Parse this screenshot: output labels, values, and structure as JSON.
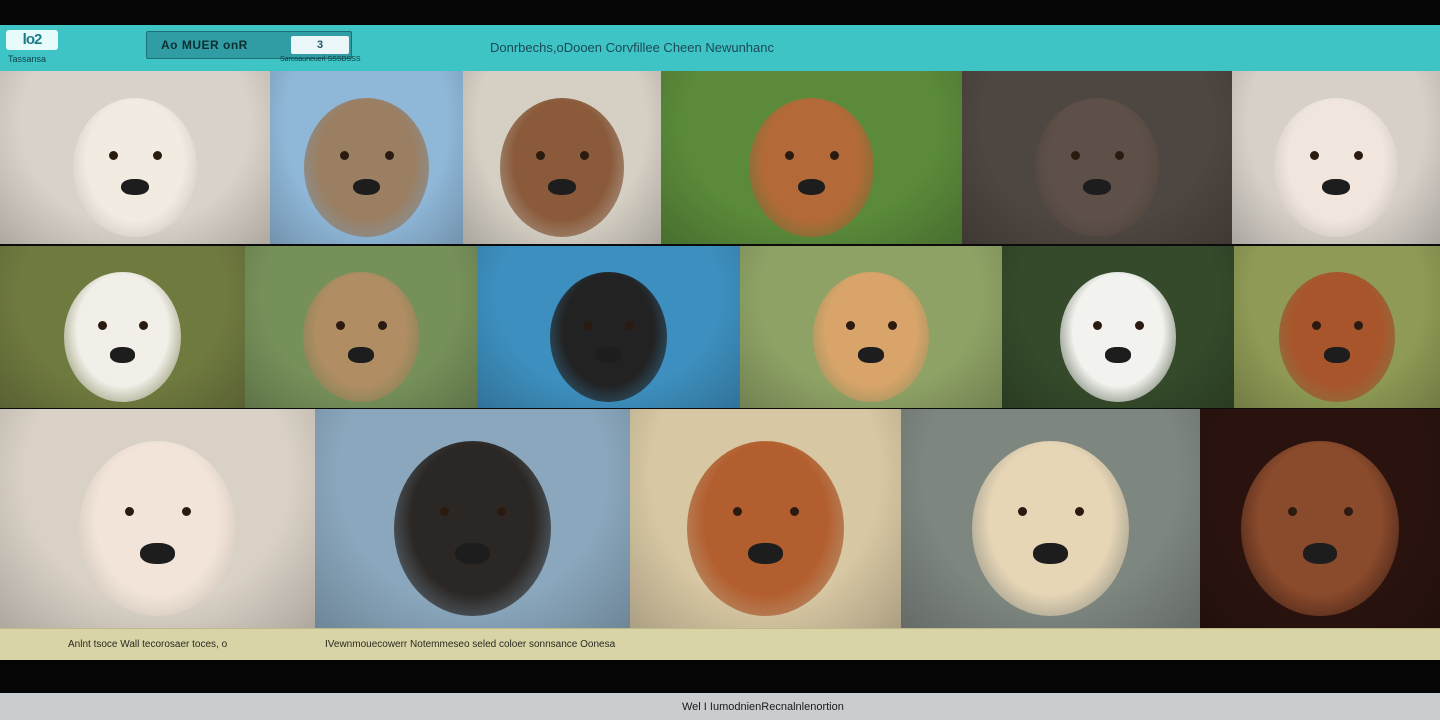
{
  "header": {
    "logo": "lo2",
    "logo_sub": "Tassansa",
    "brand_label": "Ao MUER onR",
    "brand_badge": "3",
    "brand_sub": "Sarcoauneuerl SSSDSSS",
    "title": "Donrbechs,oDooen Corvfillee Cheen Newunhanc"
  },
  "tiles": [
    {
      "label": "Dog photo 1",
      "bg": "#d9d2c8",
      "fur": "#f1ebe2"
    },
    {
      "label": "Dog photo 2",
      "bg": "#8fb7d8",
      "fur": "#9a7f63"
    },
    {
      "label": "Dog photo 3",
      "bg": "#d5cfc4",
      "fur": "#8a5a3a"
    },
    {
      "label": "Dog photo 4",
      "bg": "#5a8a3a",
      "fur": "#b36a38"
    },
    {
      "label": "Dog photo 5",
      "bg": "#4e4640",
      "fur": "#5e5048"
    },
    {
      "label": "Dog photo 6",
      "bg": "#d6d0c8",
      "fur": "#f0e6de"
    },
    {
      "label": "Dog photo 7",
      "bg": "#6f7a3f",
      "fur": "#f2efe8"
    },
    {
      "label": "Dog photo 8",
      "bg": "#76905a",
      "fur": "#b08d63"
    },
    {
      "label": "Dog photo 9",
      "bg": "#3d8fbf",
      "fur": "#222222"
    },
    {
      "label": "Dog photo 10",
      "bg": "#8ea265",
      "fur": "#d9a46a"
    },
    {
      "label": "Dog photo 11",
      "bg": "#344a2a",
      "fur": "#f2f2ef"
    },
    {
      "label": "Dog photo 12",
      "bg": "#8e9a55",
      "fur": "#a8552c"
    },
    {
      "label": "Dog photo 13",
      "bg": "#d9d1c6",
      "fur": "#f2e4d8"
    },
    {
      "label": "Dog photo 14",
      "bg": "#8aa7bd",
      "fur": "#2b2724"
    },
    {
      "label": "Dog photo 15",
      "bg": "#d7c7a3",
      "fur": "#b35e2e"
    },
    {
      "label": "Dog photo 16",
      "bg": "#7e8680",
      "fur": "#e7d6b6"
    },
    {
      "label": "Dog photo 17",
      "bg": "#2a130f",
      "fur": "#8a4a2c"
    }
  ],
  "caption": {
    "left": "Anlnt tsoce Wall tecorosaer toces, o",
    "right": "IVewnmouecowerr Notemmeseo seled coloer sonnsance  Oonesa"
  },
  "footer": {
    "text": "Wel I IumodnienRecnalnlenortion"
  }
}
